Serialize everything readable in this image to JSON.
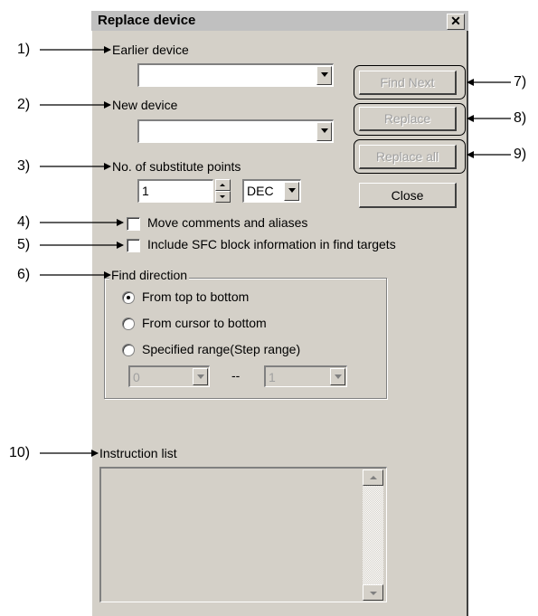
{
  "dialog": {
    "title": "Replace device",
    "close_glyph": "✕",
    "earlier_device_label": "Earlier device",
    "earlier_device_value": "",
    "new_device_label": "New device",
    "new_device_value": "",
    "substitute_points_label": "No. of substitute points",
    "substitute_points_value": "1",
    "radix_value": "DEC",
    "move_comments_label": "Move comments and aliases",
    "move_comments_checked": false,
    "include_sfc_label": "Include SFC block information in find targets",
    "include_sfc_checked": false,
    "find_direction_label": "Find direction",
    "radio_options": [
      "From top to bottom",
      "From cursor to bottom",
      "Specified range(Step range)"
    ],
    "radio_selected": "From top to bottom",
    "range_from": "0",
    "range_separator": "--",
    "range_to": "1",
    "instruction_list_label": "Instruction list",
    "buttons": {
      "find_next": "Find Next",
      "replace": "Replace",
      "replace_all": "Replace all",
      "close": "Close"
    }
  },
  "callouts": [
    "1)",
    "2)",
    "3)",
    "4)",
    "5)",
    "6)",
    "7)",
    "8)",
    "9)",
    "10)"
  ],
  "colors": {
    "dialog_bg": "#d4d0c8",
    "titlebar": "#c0c0c0",
    "disabled_text": "#a0a0a0"
  }
}
